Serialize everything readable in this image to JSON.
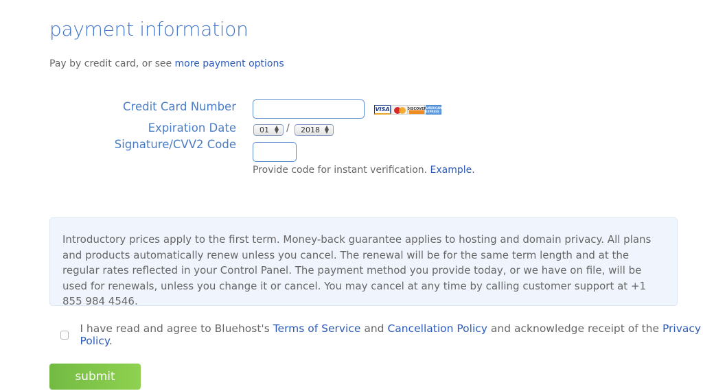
{
  "header": {
    "title": "payment information",
    "subtitle_prefix": "Pay by credit card, or see ",
    "subtitle_link": "more payment options"
  },
  "form": {
    "credit_card_label": "Credit Card Number",
    "credit_card_value": "",
    "expiration_label": "Expiration Date",
    "expiration_month": "01",
    "expiration_separator": "/",
    "expiration_year": "2018",
    "cvv_label": "Signature/CVV2 Code",
    "cvv_value": "",
    "help_text": "Provide code for instant verification. ",
    "help_link": "Example.",
    "card_icons": [
      "visa-icon",
      "mastercard-icon",
      "discover-icon",
      "amex-icon"
    ],
    "card_labels": {
      "visa": "VISA",
      "discover": "DISCOVER",
      "amex": "AMERICAN EXPRESS"
    }
  },
  "notice": {
    "text": "Introductory prices apply to the first term. Money-back guarantee applies to hosting and domain privacy. All plans and products automatically renew unless you cancel. The renewal will be for the same term length and at the regular rates reflected in your Control Panel. The payment method you provide today, or we have on file, will be used for renewals, unless you change it or cancel. You may cancel at any time by calling customer support at +1 855 984 4546."
  },
  "agreement": {
    "checked": false,
    "text_1": "I have read and agree to Bluehost's ",
    "link_terms": "Terms of Service",
    "text_2": " and ",
    "link_cancellation": "Cancellation Policy",
    "text_3": " and acknowledge receipt of the ",
    "link_privacy": "Privacy Policy",
    "text_4": "."
  },
  "actions": {
    "submit_label": "submit"
  },
  "colors": {
    "accent_blue": "#3f74c9",
    "link_blue": "#2b5ab8",
    "submit_green": "#7cc447",
    "notice_bg": "#f0f5fd"
  }
}
